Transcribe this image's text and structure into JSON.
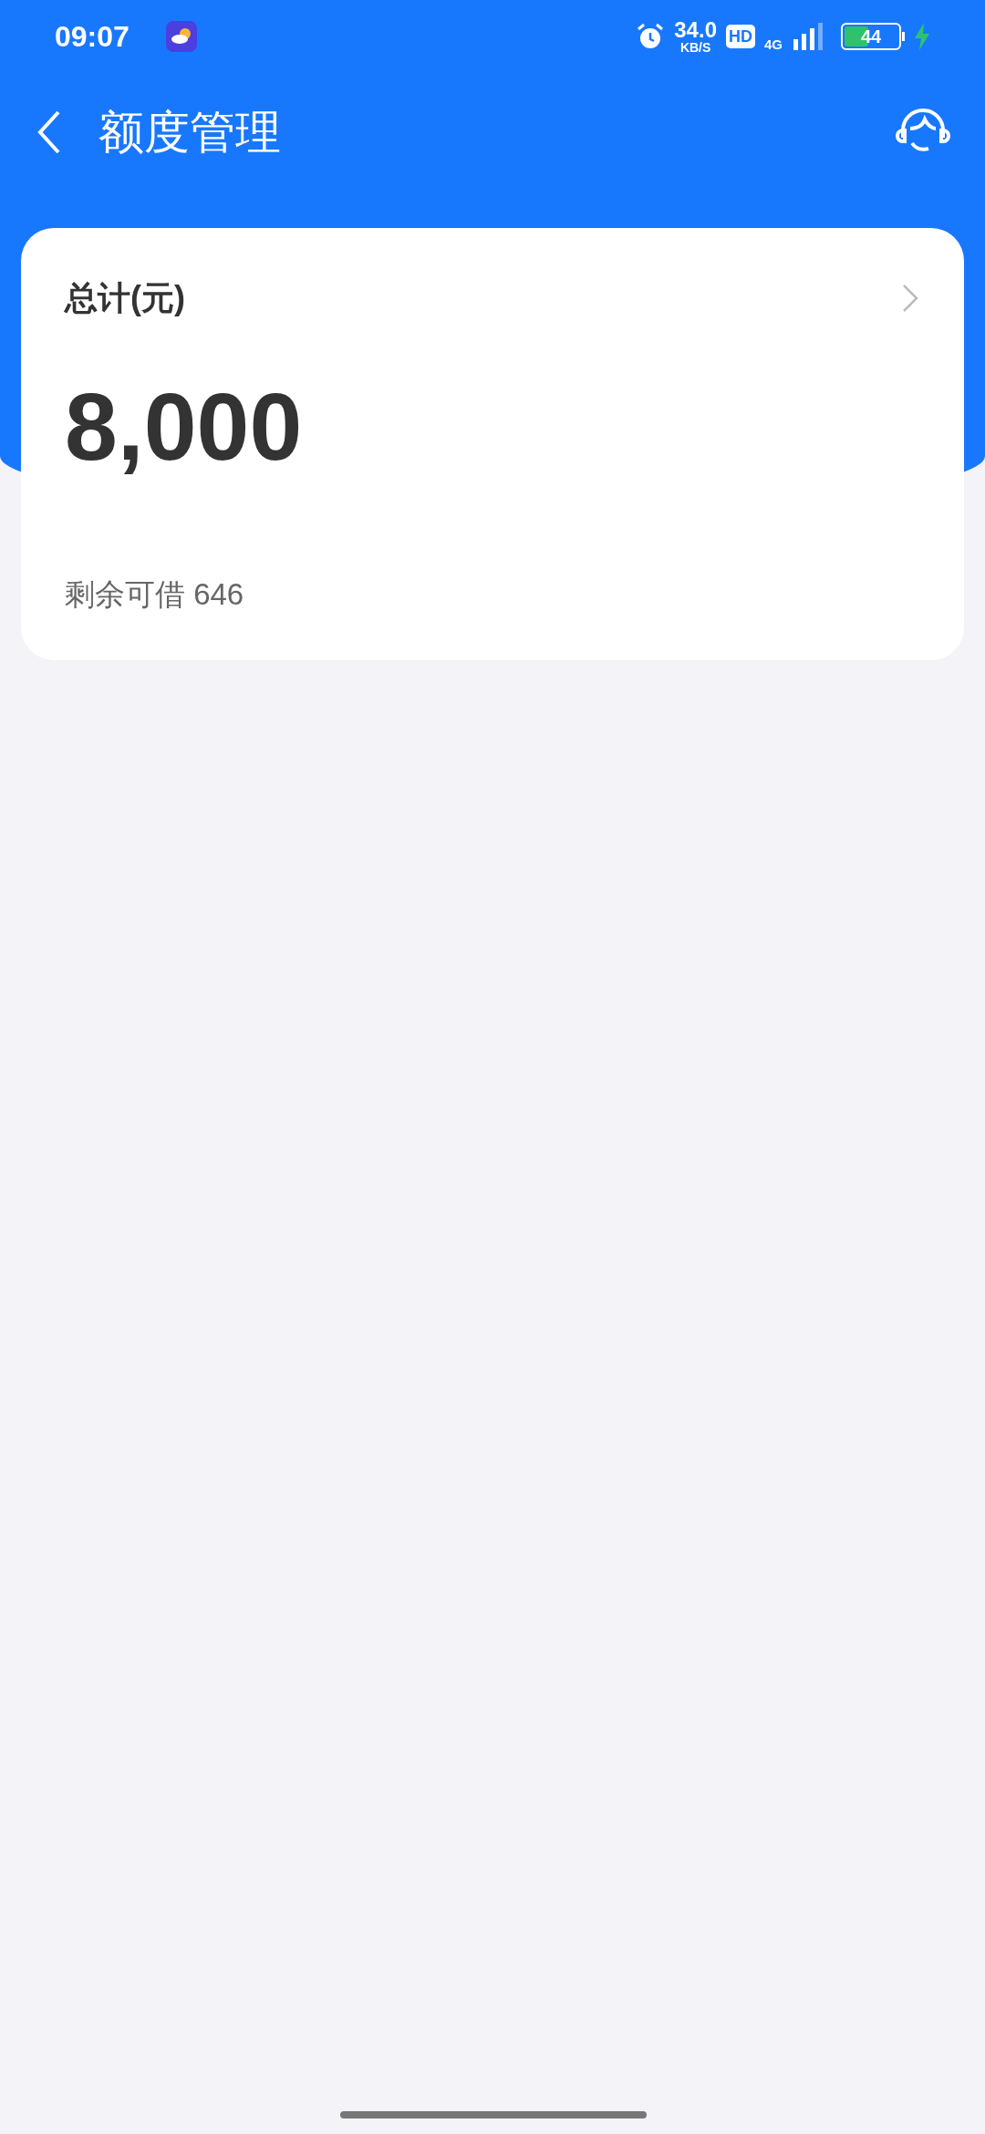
{
  "status_bar": {
    "time": "09:07",
    "net_speed": "34.0",
    "net_speed_unit": "KB/S",
    "hd": "HD",
    "network": "4G",
    "battery": "44",
    "charging": true
  },
  "header": {
    "title": "额度管理"
  },
  "card": {
    "title": "总计(元)",
    "amount": "8,000",
    "remaining": "剩余可借 646"
  }
}
